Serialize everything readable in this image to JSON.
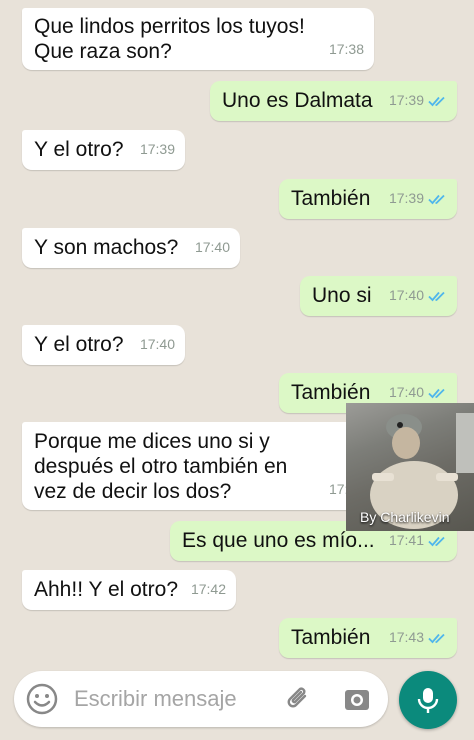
{
  "messages": [
    {
      "text": "Que lindos perritos los tuyos!\nQue raza son?",
      "time": "17:38",
      "dir": "in"
    },
    {
      "text": "Uno es Dalmata",
      "time": "17:39",
      "dir": "out"
    },
    {
      "text": "Y el otro?",
      "time": "17:39",
      "dir": "in"
    },
    {
      "text": "También",
      "time": "17:39",
      "dir": "out"
    },
    {
      "text": "Y son machos?",
      "time": "17:40",
      "dir": "in"
    },
    {
      "text": "Uno si",
      "time": "17:40",
      "dir": "out"
    },
    {
      "text": "Y el otro?",
      "time": "17:40",
      "dir": "in"
    },
    {
      "text": "También",
      "time": "17:40",
      "dir": "out"
    },
    {
      "text": "Porque me dices uno si y\ndespués el otro también en\nvez de decir los dos?",
      "time": "17:41",
      "dir": "in"
    },
    {
      "text": "Es que uno es mío...",
      "time": "17:41",
      "dir": "out"
    },
    {
      "text": "Ahh!! Y el otro?",
      "time": "17:42",
      "dir": "in"
    },
    {
      "text": "También",
      "time": "17:43",
      "dir": "out"
    }
  ],
  "image_caption": "By Charlikevin",
  "input": {
    "placeholder": "Escribir mensaje"
  },
  "icons": {
    "emoji": "smiley-icon",
    "attach": "paperclip-icon",
    "camera": "camera-icon",
    "mic": "microphone-icon",
    "read_receipt": "double-check-icon"
  },
  "colors": {
    "background": "#e8e2d9",
    "incoming": "#ffffff",
    "outgoing": "#dcf8c6",
    "ticks": "#4fb6ec",
    "mic_button": "#0b8a7c"
  }
}
